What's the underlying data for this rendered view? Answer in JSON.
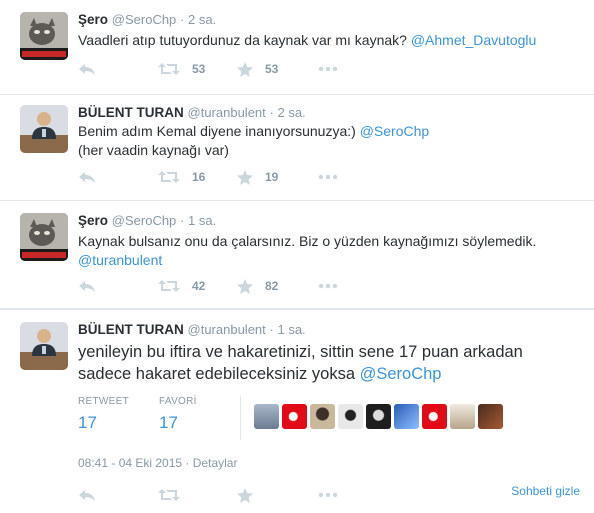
{
  "tweets": [
    {
      "name": "Şero",
      "handle": "@SeroChp",
      "time": "2 sa.",
      "text": "Vaadleri atıp tutuyordunuz da kaynak var mı kaynak?",
      "mention": "@Ahmet_Davutoglu",
      "retweets": "53",
      "favorites": "53"
    },
    {
      "name": "BÜLENT TURAN",
      "handle": "@turanbulent",
      "time": "2 sa.",
      "text": "Benim adım Kemal diyene inanıyorsunuzya:)",
      "mention": "@SeroChp",
      "text2": "(her vaadin kaynağı var)",
      "retweets": "16",
      "favorites": "19"
    },
    {
      "name": "Şero",
      "handle": "@SeroChp",
      "time": "1 sa.",
      "text": "Kaynak bulsanız onu da çalarsınız. Biz o yüzden kaynağımızı söylemedik.",
      "mention": "@turanbulent",
      "retweets": "42",
      "favorites": "82"
    },
    {
      "name": "BÜLENT TURAN",
      "handle": "@turanbulent",
      "time": "1 sa.",
      "text": "yenileyin bu iftira ve hakaretinizi, sittin sene 17 puan arkadan sadece hakaret edebileceksiniz yoksa",
      "mention": "@SeroChp"
    }
  ],
  "expanded": {
    "retweet_label": "RETWEET",
    "retweet_count": "17",
    "favorite_label": "FAVORİ",
    "favorite_count": "17",
    "timestamp": "08:41 - 04 Eki 2015",
    "details": "Detaylar",
    "hide": "Sohbeti gizle"
  },
  "colors": {
    "link": "#3b94d9",
    "muted": "#8899a6",
    "icon": "#ccd6dd",
    "border": "#e1e8ed"
  }
}
